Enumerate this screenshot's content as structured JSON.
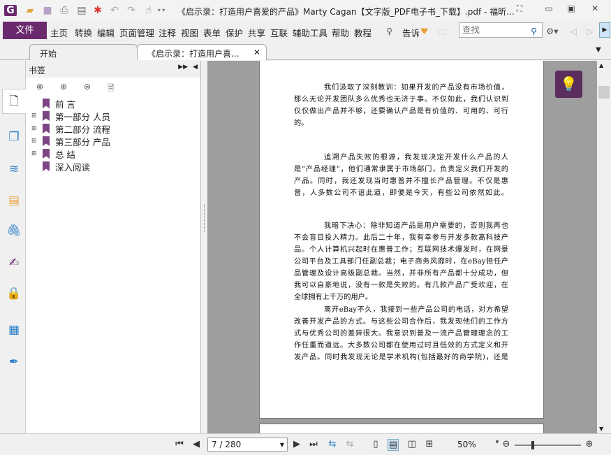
{
  "window": {
    "title": "《启示录：打造用户喜爱的产品》Marty Cagan【文字版_PDF电子书_下载】.pdf - 福昕..."
  },
  "menu": {
    "file": "文件",
    "items": [
      "主页",
      "转换",
      "编辑",
      "页面管理",
      "注释",
      "视图",
      "表单",
      "保护",
      "共享",
      "互联",
      "辅助工具",
      "帮助",
      "教程"
    ],
    "tell": "告诉",
    "search_placeholder": "查找"
  },
  "tabs": [
    {
      "label": "开始"
    },
    {
      "label": "《启示录：打造用户喜..."
    }
  ],
  "bookmarks": {
    "title": "书签",
    "items": [
      {
        "label": "前 言",
        "expandable": false
      },
      {
        "label": "第一部分 人员",
        "expandable": true
      },
      {
        "label": "第二部分 流程",
        "expandable": true
      },
      {
        "label": "第三部分 产品",
        "expandable": true
      },
      {
        "label": "总 结",
        "expandable": true
      },
      {
        "label": "深入阅读",
        "expandable": false
      }
    ]
  },
  "document": {
    "paragraphs": [
      [
        "我们汲取了深刻教训：如果开发的产品没有市场价值，",
        "那么无论开发团队多么优秀也无济于事。不仅如此，我们认识到",
        "仅仅做出产品并不够，还要确认产品是有价值的、可用的、可行",
        "的。"
      ],
      [
        "追溯产品失败的根源，我发现决定开发什么产品的人",
        "是“产品经理”，他们通常隶属于市场部门，负责定义我们开发的",
        "产品。同时，我还发现当时惠普并不擅长产品管理。不仅是惠",
        "普，人多数公司不谙此道，即便是今天，有些公司依然如此。"
      ],
      [
        "我暗下决心：除非知道产品是用户需要的，否则我再也",
        "不会盲目投入精力。此后二十年，我有幸参与开发多款高科技产",
        "品。个人计算机兴起时在惠普工作；互联网技术爆发时，在网景",
        "公司平台及工具部门任副总裁；电子商务风靡时，在eBay担任产",
        "品管理及设计高级副总裁。当然，并非所有产品都十分成功，但",
        "我可以自豪地说，没有一款是失败的。有几款产品广受欢迎，在",
        "全球拥有上千万的用户。"
      ],
      [
        "离开eBay不久，我接到一些产品公司的电话，对方希望",
        "改善开发产品的方式。与这些公司合作后，我发现他们的工作方",
        "式与优秀公司的差异很大。我意识到普及一流产品管理理念的工",
        "作任重而道远。大多数公司都在使用过时且低效的方式定义和开",
        "发产品。同时我发现无论是学术机构(包括最好的商学院)，还是"
      ]
    ]
  },
  "status": {
    "page": "7 / 280",
    "zoom": "50%",
    "zoom_fraction": 0.5
  },
  "colors": {
    "accent": "#6b2a6e",
    "bookmark": "#7c4583"
  }
}
